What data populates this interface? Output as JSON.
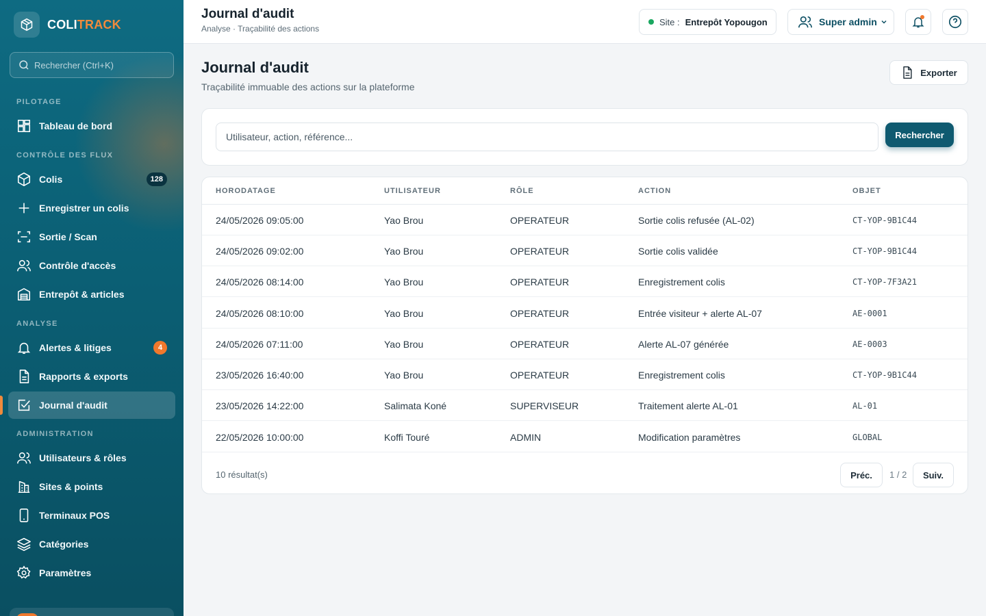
{
  "brand": {
    "name_part1": "COLI",
    "name_part2": "TRACK"
  },
  "sidebar": {
    "search_placeholder": "Rechercher (Ctrl+K)",
    "sections": {
      "pilotage": "PILOTAGE",
      "flux": "CONTRÔLE DES FLUX",
      "analyse": "ANALYSE",
      "admin": "ADMINISTRATION"
    },
    "items": {
      "dashboard": "Tableau de bord",
      "colis": "Colis",
      "colis_badge": "128",
      "register": "Enregistrer un colis",
      "exit_scan": "Sortie / Scan",
      "access": "Contrôle d'accès",
      "warehouse": "Entrepôt & articles",
      "alerts": "Alertes & litiges",
      "alerts_badge": "4",
      "reports": "Rapports & exports",
      "audit": "Journal d'audit",
      "users": "Utilisateurs & rôles",
      "sites": "Sites & points",
      "pos": "Terminaux POS",
      "categories": "Catégories",
      "settings": "Paramètres"
    }
  },
  "header": {
    "title": "Journal d'audit",
    "breadcrumb": "Analyse · Traçabilité des actions",
    "site_label": "Site :",
    "site_value": "Entrepôt Yopougon",
    "user_role": "Super admin"
  },
  "main": {
    "title": "Journal d'audit",
    "subtitle": "Traçabilité immuable des actions sur la plateforme",
    "export_label": "Exporter",
    "search_placeholder": "Utilisateur, action, référence...",
    "search_button": "Rechercher"
  },
  "table": {
    "columns": {
      "timestamp": "HORODATAGE",
      "user": "UTILISATEUR",
      "role": "RÔLE",
      "action": "ACTION",
      "object": "OBJET"
    },
    "rows": [
      {
        "timestamp": "24/05/2026 09:05:00",
        "user": "Yao Brou",
        "role": "OPERATEUR",
        "action": "Sortie colis refusée (AL-02)",
        "object": "CT-YOP-9B1C44"
      },
      {
        "timestamp": "24/05/2026 09:02:00",
        "user": "Yao Brou",
        "role": "OPERATEUR",
        "action": "Sortie colis validée",
        "object": "CT-YOP-9B1C44"
      },
      {
        "timestamp": "24/05/2026 08:14:00",
        "user": "Yao Brou",
        "role": "OPERATEUR",
        "action": "Enregistrement colis",
        "object": "CT-YOP-7F3A21"
      },
      {
        "timestamp": "24/05/2026 08:10:00",
        "user": "Yao Brou",
        "role": "OPERATEUR",
        "action": "Entrée visiteur + alerte AL-07",
        "object": "AE-0001"
      },
      {
        "timestamp": "24/05/2026 07:11:00",
        "user": "Yao Brou",
        "role": "OPERATEUR",
        "action": "Alerte AL-07 générée",
        "object": "AE-0003"
      },
      {
        "timestamp": "23/05/2026 16:40:00",
        "user": "Yao Brou",
        "role": "OPERATEUR",
        "action": "Enregistrement colis",
        "object": "CT-YOP-9B1C44"
      },
      {
        "timestamp": "23/05/2026 14:22:00",
        "user": "Salimata Koné",
        "role": "SUPERVISEUR",
        "action": "Traitement alerte AL-01",
        "object": "AL-01"
      },
      {
        "timestamp": "22/05/2026 10:00:00",
        "user": "Koffi Touré",
        "role": "ADMIN",
        "action": "Modification paramètres",
        "object": "GLOBAL"
      }
    ],
    "result_count": "10 résultat(s)",
    "prev_label": "Préc.",
    "page_info": "1 / 2",
    "next_label": "Suiv."
  },
  "colors": {
    "brand_teal": "#0e6b82",
    "accent_orange": "#f08a3c",
    "primary_button": "#0f5a70"
  }
}
